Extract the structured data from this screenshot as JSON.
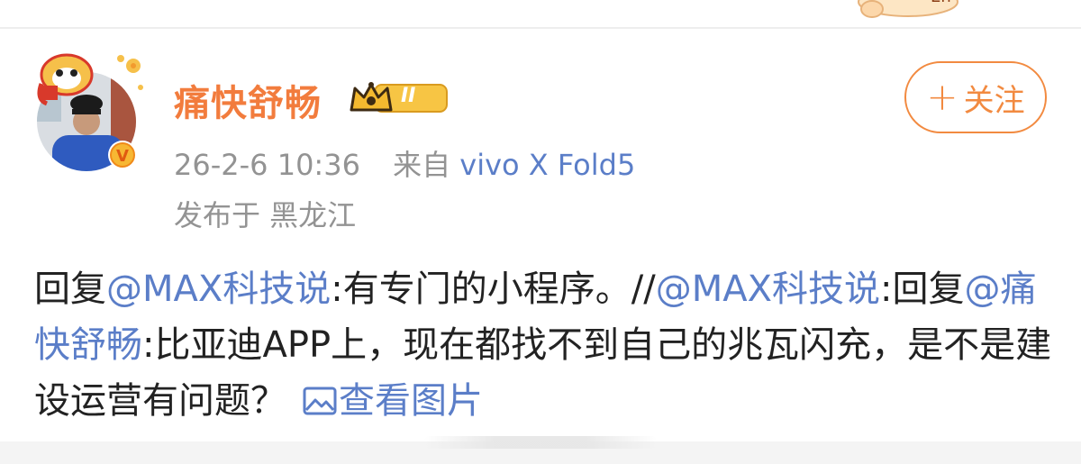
{
  "post": {
    "author": {
      "name": "痛快舒畅",
      "level": "II",
      "verified": true
    },
    "follow_label": "关注",
    "follow_icon": "plus-icon",
    "time": "26-2-6 10:36",
    "source_prefix": "来自",
    "device": "vivo X Fold5",
    "location": "发布于 黑龙江",
    "body": {
      "reply1": "回复",
      "mention1": "@MAX科技说",
      "text1": ":有专门的小程序。//",
      "mention2": "@MAX科技说",
      "text2": ":回复",
      "mention3": "@痛快舒畅",
      "text3": ":比亚迪APP上，现在都找不到自己的兆瓦闪充，是不是建设运营有问题？",
      "view_image": "查看图片"
    }
  },
  "colors": {
    "accent": "#f27c3d",
    "link": "#5b7ec8",
    "meta": "#939393",
    "text": "#222222"
  }
}
